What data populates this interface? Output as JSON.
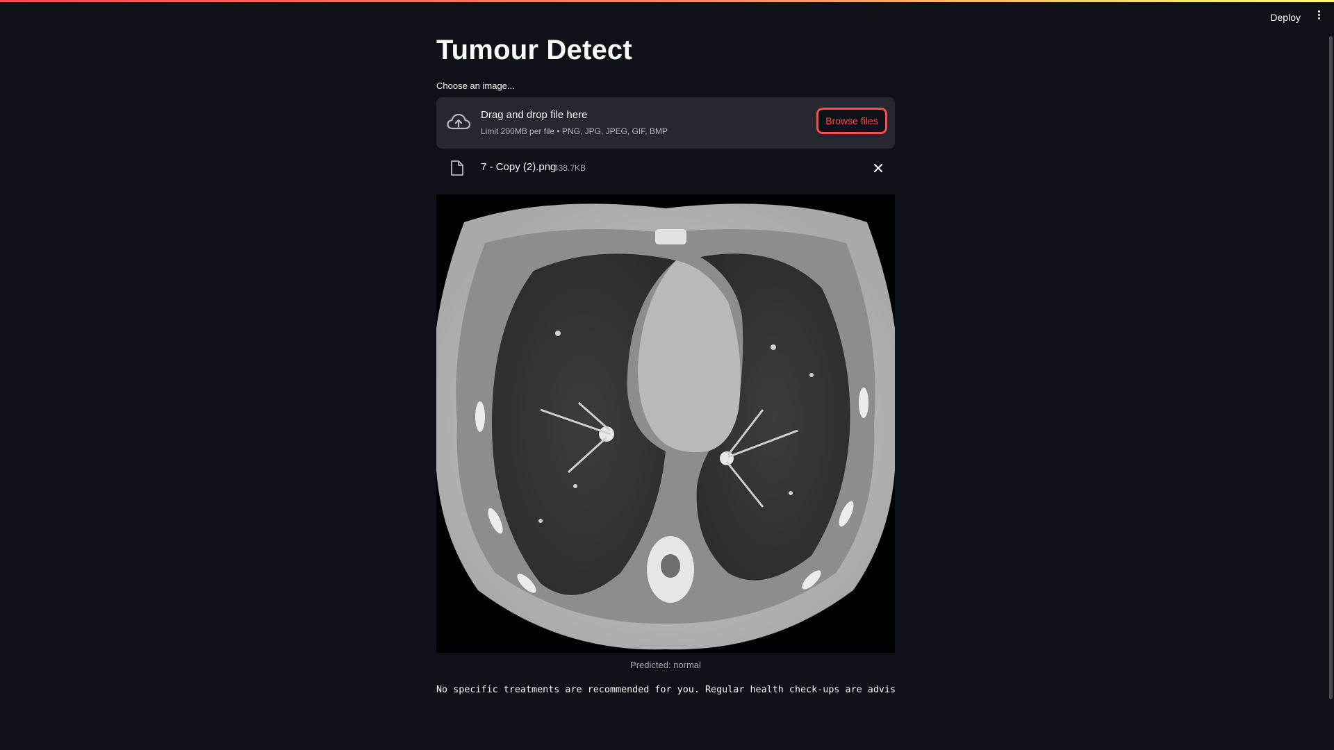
{
  "header": {
    "deploy_label": "Deploy",
    "menu_icon": "more-vertical-icon"
  },
  "main": {
    "title": "Tumour Detect",
    "uploader": {
      "label": "Choose an image...",
      "dropzone_title": "Drag and drop file here",
      "dropzone_hint": "Limit 200MB per file • PNG, JPG, JPEG, GIF, BMP",
      "browse_label": "Browse files",
      "icon": "cloud-upload-icon"
    },
    "uploaded_file": {
      "name": "7 - Copy (2).png",
      "size": "438.7KB",
      "icon": "file-icon",
      "remove_icon": "close-icon"
    },
    "image": {
      "caption": "Predicted: normal"
    },
    "recommendation": "No specific treatments are recommended for you. Regular health check-ups are advised"
  },
  "colors": {
    "background": "#0e1117",
    "surface": "#262730",
    "accent": "#ff4b4b",
    "text": "#fafafa",
    "muted": "#a4a7ae"
  }
}
